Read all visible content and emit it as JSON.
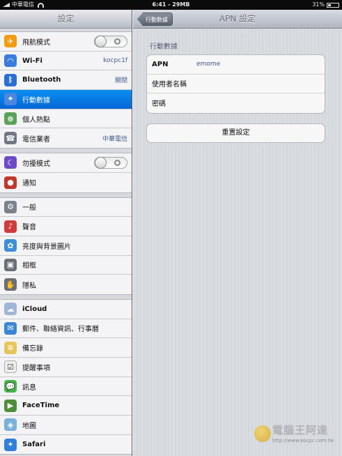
{
  "status_bar": {
    "carrier": "中華電信",
    "time": "6:41 - 29MB",
    "battery": "31%",
    "battery_level": 0.31
  },
  "master": {
    "title": "設定",
    "groups": [
      [
        {
          "label": "飛航模式",
          "icon": "airplane-icon",
          "toggle": "off"
        },
        {
          "label": "Wi-Fi",
          "icon": "wifi-icon",
          "value": "kocpc1f"
        },
        {
          "label": "Bluetooth",
          "icon": "bluetooth-icon",
          "value": "關閉"
        },
        {
          "label": "行動數據",
          "icon": "cellular-icon",
          "selected": true
        },
        {
          "label": "個人熱點",
          "icon": "hotspot-icon"
        },
        {
          "label": "電信業者",
          "icon": "phone-icon",
          "value": "中華電信"
        }
      ],
      [
        {
          "label": "勿擾模式",
          "icon": "moon-icon",
          "toggle": "off"
        },
        {
          "label": "通知",
          "icon": "notifications-icon"
        }
      ],
      [
        {
          "label": "一般",
          "icon": "gear-icon"
        },
        {
          "label": "聲音",
          "icon": "speaker-icon"
        },
        {
          "label": "亮度與背景圖片",
          "icon": "wallpaper-icon"
        },
        {
          "label": "相框",
          "icon": "picture-frame-icon"
        },
        {
          "label": "隱私",
          "icon": "hand-icon"
        }
      ],
      [
        {
          "label": "iCloud",
          "icon": "cloud-icon"
        },
        {
          "label": "郵件、聯絡資訊、行事曆",
          "icon": "mail-icon"
        },
        {
          "label": "備忘錄",
          "icon": "notes-icon"
        },
        {
          "label": "提醒事項",
          "icon": "reminders-icon"
        },
        {
          "label": "訊息",
          "icon": "messages-icon"
        },
        {
          "label": "FaceTime",
          "icon": "facetime-icon"
        },
        {
          "label": "地圖",
          "icon": "maps-icon"
        },
        {
          "label": "Safari",
          "icon": "compass-icon"
        }
      ]
    ]
  },
  "detail": {
    "back_label": "行動數據",
    "title": "APN 設定",
    "section_header": "行動數據",
    "fields": [
      {
        "label": "APN",
        "value": "emome"
      },
      {
        "label": "使用者名稱",
        "value": ""
      },
      {
        "label": "密碼",
        "value": ""
      }
    ],
    "reset_label": "重置設定"
  },
  "watermark": {
    "text": "電腦王阿達",
    "url": "http://www.kocpc.com.tw"
  }
}
